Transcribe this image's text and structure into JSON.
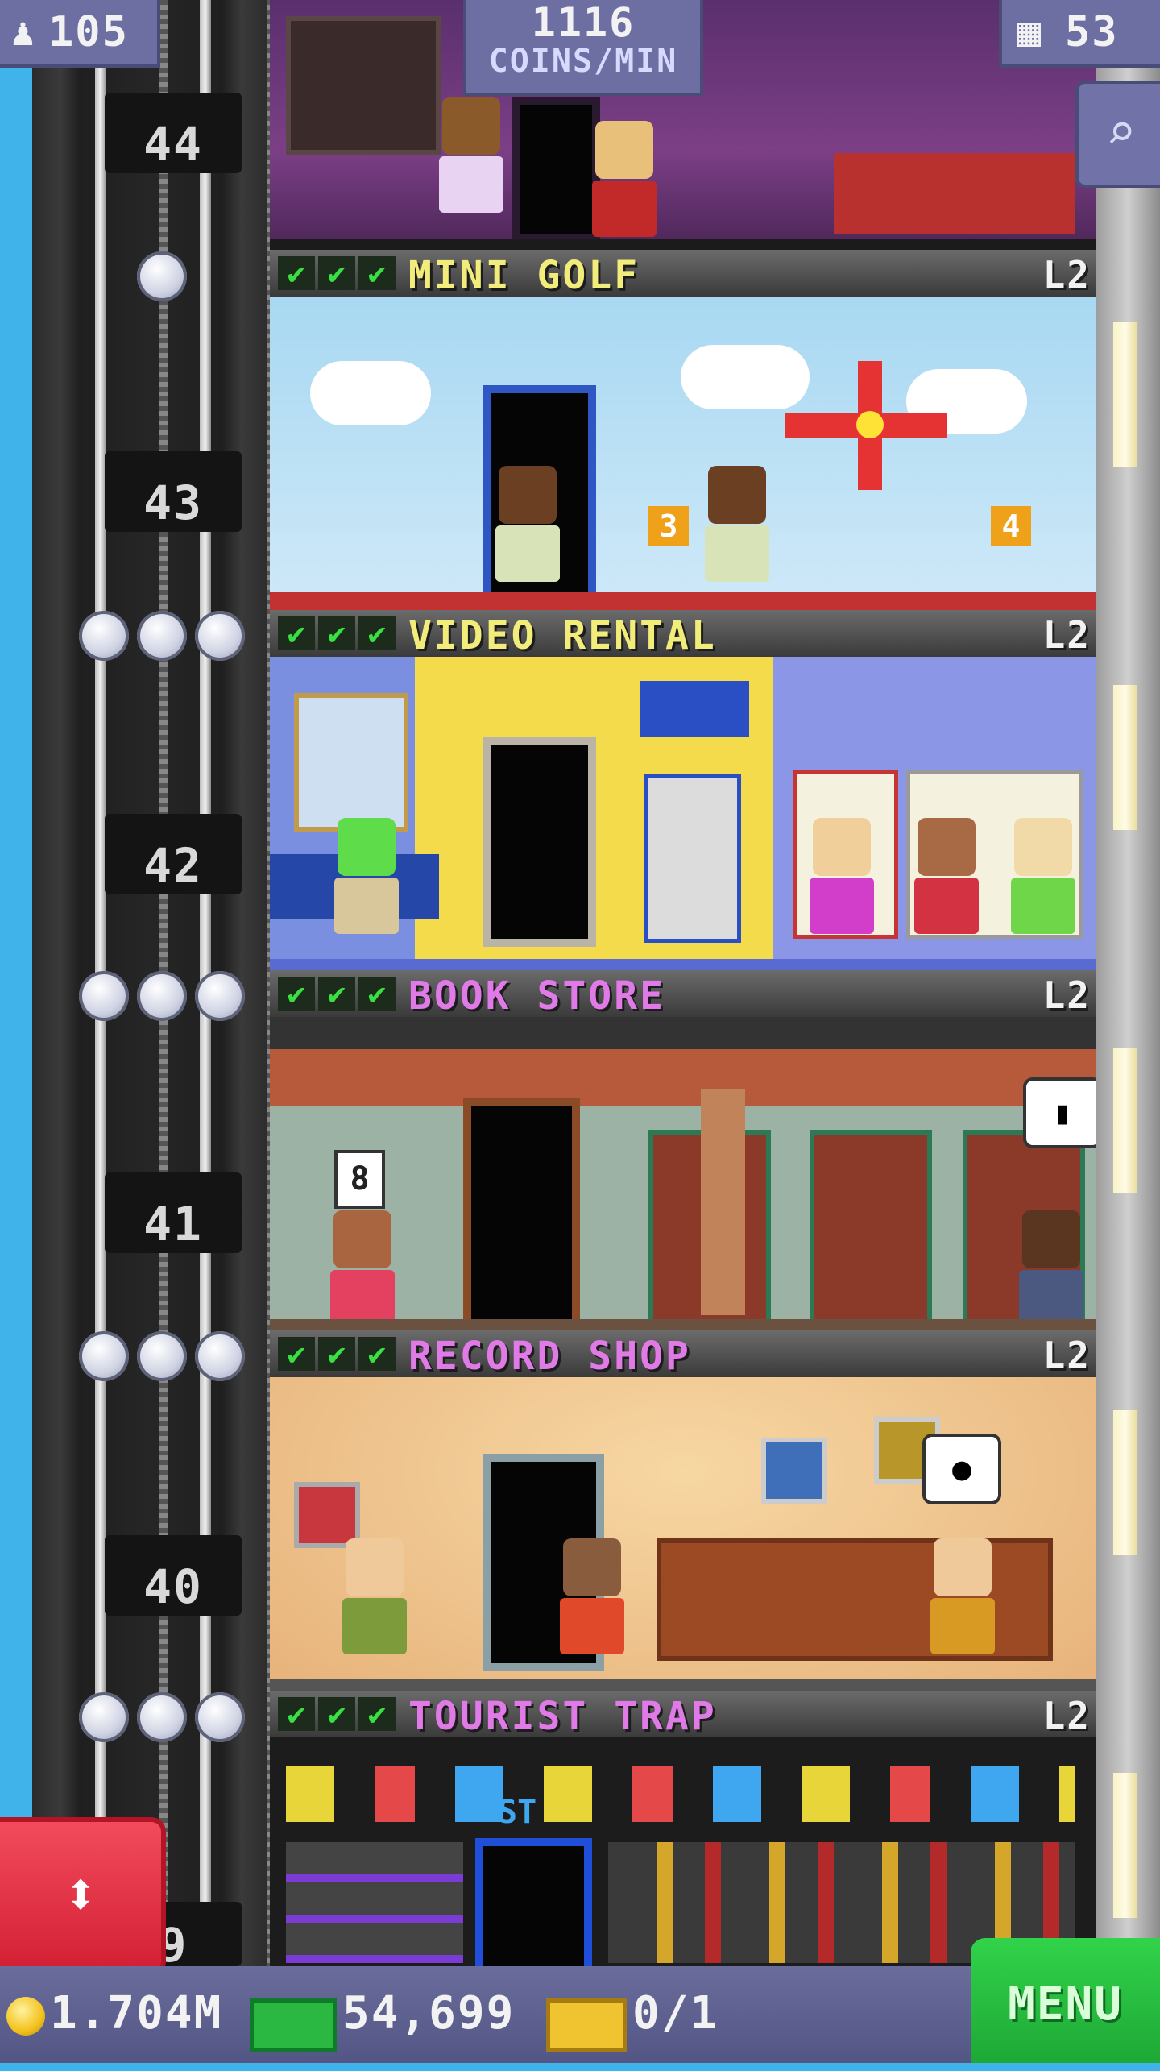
{
  "hud": {
    "population": "105",
    "population_icon": "person-icon",
    "coins_per_min_value": "1116",
    "coins_per_min_label": "COINS/MIN",
    "floors_count": "53",
    "floors_icon": "building-icon",
    "zoom_icon": "magnifier-icon"
  },
  "shaft": {
    "floor_numbers": [
      "44",
      "43",
      "42",
      "41",
      "40",
      "9"
    ]
  },
  "floors": [
    {
      "name": "MINI GOLF",
      "level": "L2",
      "checks": [
        "✔",
        "✔",
        "✔"
      ],
      "name_color": "#f2ed7a",
      "signs": [
        "3",
        "4"
      ]
    },
    {
      "name": "VIDEO RENTAL",
      "level": "L2",
      "checks": [
        "✔",
        "✔",
        "✔"
      ],
      "name_color": "#f2ed7a"
    },
    {
      "name": "BOOK STORE",
      "level": "L2",
      "checks": [
        "✔",
        "✔",
        "✔"
      ],
      "name_color": "#e07ae6",
      "signs": [
        "8"
      ]
    },
    {
      "name": "RECORD SHOP",
      "level": "L2",
      "checks": [
        "✔",
        "✔",
        "✔"
      ],
      "name_color": "#e07ae6"
    },
    {
      "name": "TOURIST TRAP",
      "level": "L2",
      "checks": [
        "✔",
        "✔",
        "✔"
      ],
      "name_color": "#e07ae6",
      "signs": [
        "ST"
      ]
    }
  ],
  "bottom": {
    "coins": "1.704M",
    "coin_icon": "coin-icon",
    "bux": "54,699",
    "bux_icon": "banknote-icon",
    "tickets": "0/1",
    "ticket_icon": "ticket-icon",
    "menu_label": "MENU",
    "elevator_icon": "up-down-arrows-icon"
  },
  "colors": {
    "check_green": "#39e041",
    "menu_green": "#1ea836",
    "elevator_red": "#e0253b",
    "hud_purple": "#6d6fa3",
    "sky": "#3fb3ea"
  }
}
